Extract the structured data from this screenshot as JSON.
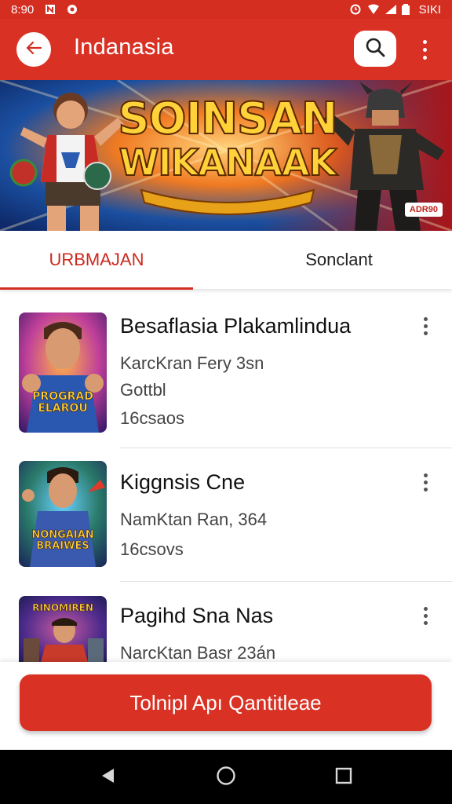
{
  "status_bar": {
    "time": "8:90",
    "battery_text": "SIKI"
  },
  "app_bar": {
    "title": "Indanasia"
  },
  "banner": {
    "line1": "SOINSAN",
    "line2": "WIKANAAK",
    "badge": "ADR90"
  },
  "tabs": [
    {
      "label": "URBMAJAN",
      "active": true
    },
    {
      "label": "Sonclant",
      "active": false
    }
  ],
  "items": [
    {
      "title": "Besaflasia Plakamlindua",
      "line1": "KarcKran Fery 3sn",
      "line2": "Gottbl",
      "line3": "16csaos",
      "thumb_text1": "PROGRAD",
      "thumb_text2": "ELAROU"
    },
    {
      "title": "Kiggnsis Cne",
      "line1": "NamKtan Ran, 364",
      "line2": "16csovs",
      "thumb_text1": "NONGAIAN",
      "thumb_text2": "BRAIWES"
    },
    {
      "title": "Pagihd Sna Nas",
      "line1": "NarcKtan Basr 23án",
      "thumb_text1": "RINOMIREN"
    }
  ],
  "cta": {
    "label": "Tolnipl Apı Qantitleae"
  },
  "colors": {
    "primary": "#d93225",
    "accent_text": "#cc2a1f"
  },
  "icons": {
    "back": "arrow-left-icon",
    "search": "search-icon",
    "more": "more-vertical-icon"
  }
}
